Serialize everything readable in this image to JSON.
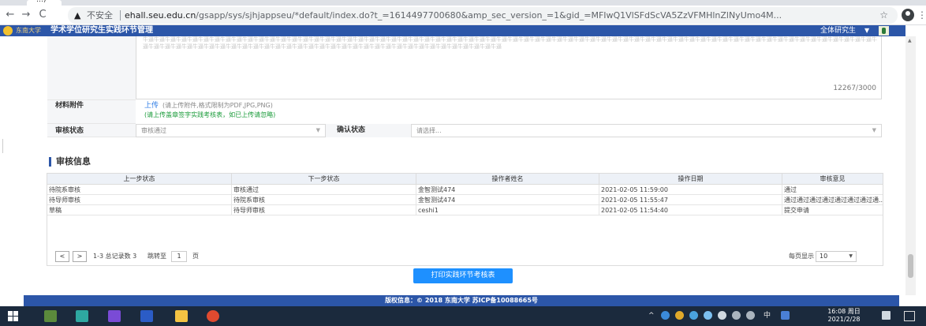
{
  "browser": {
    "tab_title": "…)",
    "insecure_label": "不安全",
    "url_host": "ehall.seu.edu.cn",
    "url_rest": "/gsapp/sys/sjhjappseu/*default/index.do?t_=1614497700680&amp_sec_version_=1&gid_=MFIwQ1VlSFdScVA5ZzVFMHlnZlNyUmo4M..."
  },
  "header": {
    "logo_text": "东南大学",
    "title": "学术学位研究生实践环节管理",
    "role": "全体研究生"
  },
  "form": {
    "textarea_text": "牛逼牛逼牛逼牛逼牛逼牛逼牛逼牛逼牛逼牛逼牛逼牛逼牛逼牛逼牛逼牛逼牛逼牛逼牛逼牛逼牛逼牛逼牛逼牛逼牛逼牛逼牛逼牛逼牛逼牛逼牛逼牛逼牛逼牛逼牛逼牛逼牛逼牛逼牛逼牛逼牛逼牛逼牛逼牛逼牛逼牛逼牛逼牛逼牛逼牛逼牛逼牛逼牛逼牛逼牛逼牛逼牛逼牛逼牛逼牛逼牛逼牛逼牛逼牛逼牛逼牛逼牛逼牛逼牛逼牛逼牛逼牛逼牛逼牛逼牛逼牛逼牛逼牛逼牛逼牛逼牛逼牛逼牛逼牛逼牛逼牛逼牛逼牛逼牛逼牛逼牛逼牛逼牛逼牛逼牛逼牛逼牛逼牛逼牛逼",
    "counter": "12267/3000",
    "attachment_label": "材料附件",
    "upload_link": "上传",
    "upload_hint": "(请上传附件,格式限制为PDF,JPG,PNG)",
    "upload_note": "(请上传盖章签字实践考核表，如已上传请忽略)",
    "review_status_label": "审核状态",
    "review_status_value": "审核通过",
    "confirm_status_label": "确认状态",
    "confirm_status_placeholder": "请选择..."
  },
  "section": {
    "title": "审核信息"
  },
  "grid": {
    "columns": [
      "上一步状态",
      "下一步状态",
      "操作者姓名",
      "操作日期",
      "审核意见"
    ],
    "rows": [
      [
        "待院系审核",
        "审核通过",
        "金智测试474",
        "2021-02-05 11:59:00",
        "通过"
      ],
      [
        "待导师审核",
        "待院系审核",
        "金智测试474",
        "2021-02-05 11:55:47",
        "通过通过通过通过通过通过通过通..."
      ],
      [
        "草稿",
        "待导师审核",
        "ceshi1",
        "2021-02-05 11:54:40",
        "提交申请"
      ]
    ],
    "pager": {
      "prev": "<",
      "next": ">",
      "summary": "1-3 总记录数 3",
      "jump_label": "跳转至",
      "page_value": "1",
      "page_unit": "页",
      "per_page_label": "每页显示",
      "per_page_value": "10"
    }
  },
  "print_button": "打印实践环节考核表",
  "footer": "版权信息：© 2018 东南大学 苏ICP备10088665号",
  "taskbar": {
    "ime": "中",
    "clock_time": "16:08 周日",
    "clock_date": "2021/2/28"
  },
  "colors": {
    "brand": "#2c56a8",
    "primary_button": "#1e90ff",
    "link": "#2c7be5",
    "note_green": "#1a9b3a"
  }
}
